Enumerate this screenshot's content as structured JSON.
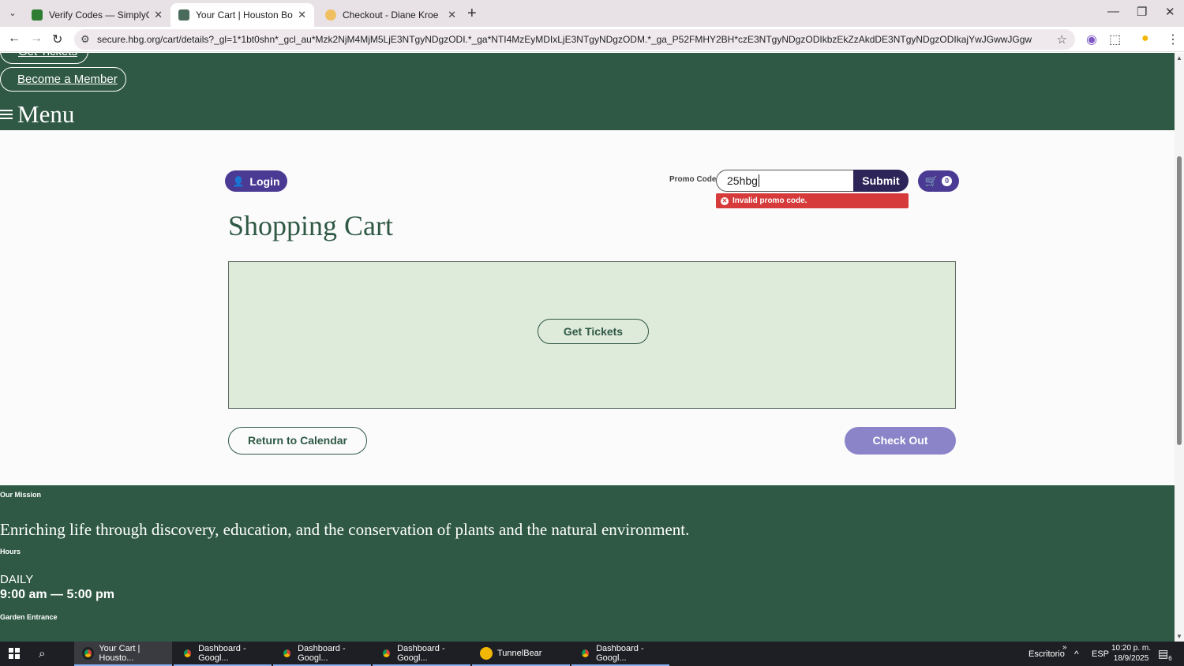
{
  "browser": {
    "tabs": [
      {
        "title": "Verify Codes — SimplyCodes",
        "active": false
      },
      {
        "title": "Your Cart | Houston Botanic Ga",
        "active": true
      },
      {
        "title": "Checkout - Diane Kroe",
        "active": false
      }
    ],
    "url": "secure.hbg.org/cart/details?_gl=1*1bt0shn*_gcl_au*Mzk2NjM4MjM5LjE3NTgyNDgzODI.*_ga*NTI4MzEyMDIxLjE3NTgyNDgzODM.*_ga_P52FMHY2BH*czE3NTgyNDgzODIkbzEkZzAkdDE3NTgyNDgzODIkajYwJGwwJGgw"
  },
  "header": {
    "tickets_link": "Get Tickets",
    "member_button": "Become a Member",
    "menu_label": "Menu"
  },
  "cart": {
    "login_label": "Login",
    "promo_label": "Promo Code",
    "promo_value": "25hbg",
    "submit_label": "Submit",
    "promo_error": "Invalid promo code.",
    "cart_count": "0",
    "title": "Shopping Cart",
    "get_tickets_label": "Get Tickets",
    "return_label": "Return to Calendar",
    "checkout_label": "Check Out"
  },
  "footer": {
    "mission_heading": "Our Mission",
    "mission_text": "Enriching life through discovery, education, and the conservation of plants and the natural environment.",
    "hours_heading": "Hours",
    "daily_label": "DAILY",
    "hours_text": "9:00 am — 5:00 pm",
    "entrance_heading": "Garden Entrance"
  },
  "taskbar": {
    "items": [
      {
        "label": "Your Cart | Housto..."
      },
      {
        "label": "Dashboard - Googl..."
      },
      {
        "label": "Dashboard - Googl..."
      },
      {
        "label": "Dashboard - Googl..."
      },
      {
        "label": "TunnelBear"
      },
      {
        "label": "Dashboard - Googl..."
      }
    ],
    "desktop_label": "Escritorio",
    "language": "ESP",
    "time": "10:20 p. m.",
    "date": "18/9/2025",
    "notification_count": "6"
  },
  "colors": {
    "header_green": "#2f5945",
    "brand_purple": "#4b3a94",
    "error_red": "#d63a3a"
  }
}
